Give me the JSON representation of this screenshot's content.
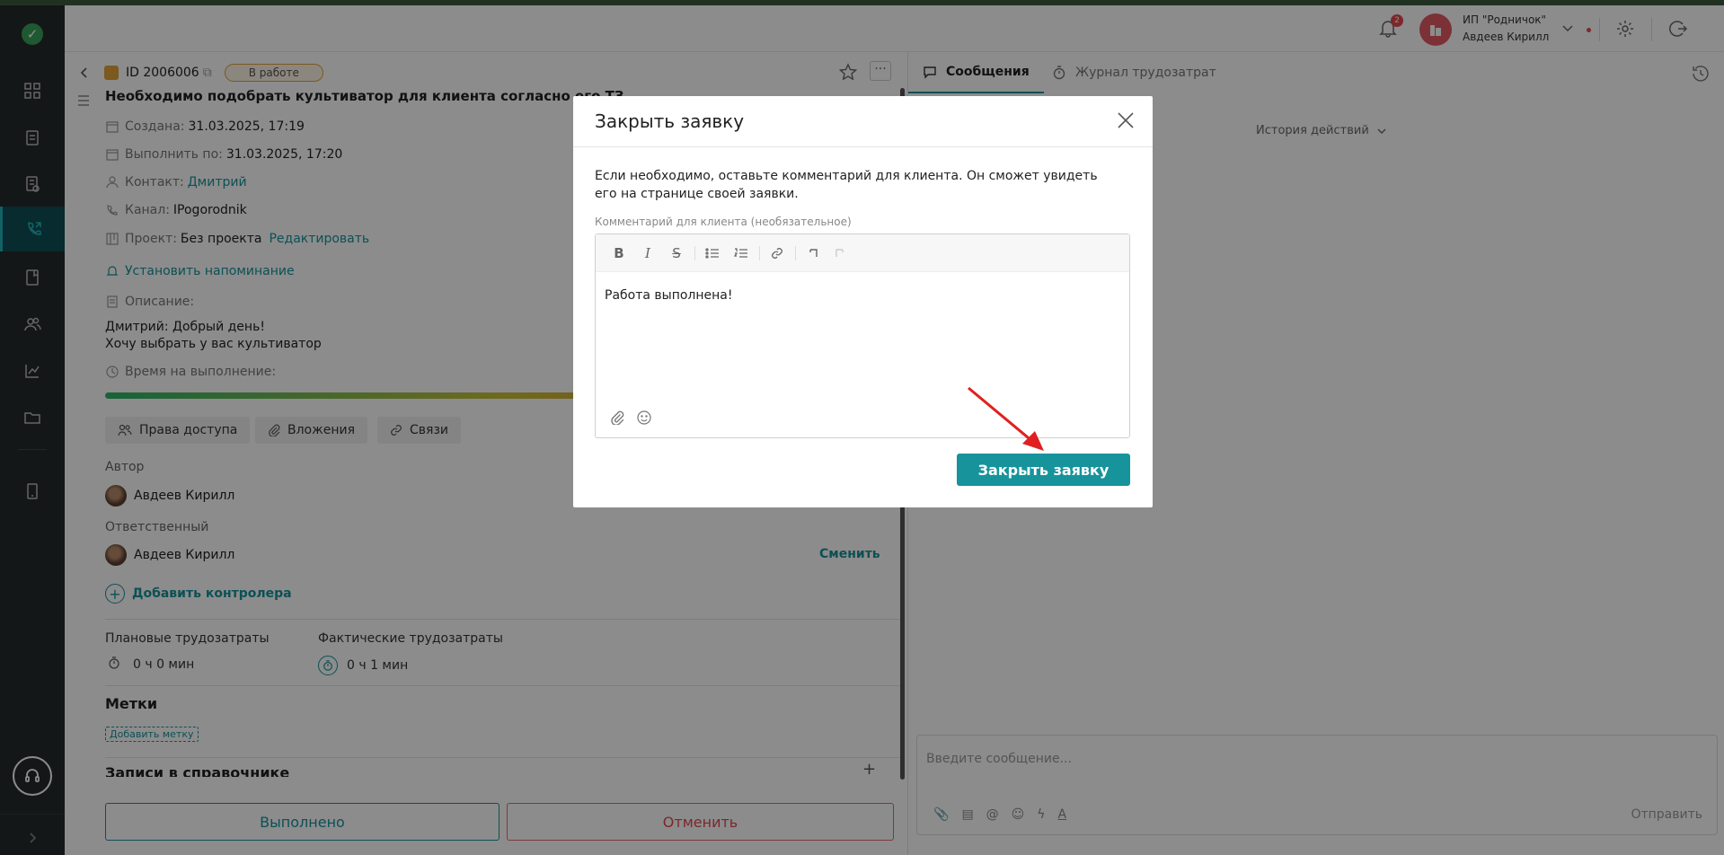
{
  "header": {
    "notifications_count": "2",
    "org_name": "ИП \"Родничок\"",
    "user_name": "Авдеев Кирилл"
  },
  "task": {
    "id": "ID 2006006",
    "status": "В работе",
    "title": "Необходимо подобрать культиватор для клиента согласно его ТЗ",
    "created_label": "Создана:",
    "created_value": "31.03.2025, 17:19",
    "due_label": "Выполнить по:",
    "due_value": "31.03.2025, 17:20",
    "contact_label": "Контакт:",
    "contact_value": "Дмитрий",
    "channel_label": "Канал:",
    "channel_value": "IPogorodnik",
    "project_label": "Проект:",
    "project_value": "Без проекта",
    "project_edit": "Редактировать",
    "reminder": "Установить напоминание",
    "description_label": "Описание:",
    "description_line1": "Дмитрий: Добрый день!",
    "description_line2": "Хочу выбрать у вас культиватор",
    "time_label": "Время на выполнение:",
    "chips": [
      "Права доступа",
      "Вложения",
      "Связи"
    ],
    "author_label": "Автор",
    "author_name": "Авдеев Кирилл",
    "responsible_label": "Ответственный",
    "responsible_name": "Авдеев Кирилл",
    "change_label": "Сменить",
    "add_controller": "Добавить контролера",
    "planned_label": "Плановые трудозатраты",
    "planned_value": "0 ч 0 мин",
    "actual_label": "Фактические трудозатраты",
    "actual_value": "0 ч 1 мин",
    "tags_label": "Метки",
    "add_tag": "Добавить метку",
    "records_label": "Записи в справочнике",
    "done_button": "Выполнено",
    "cancel_button": "Отменить"
  },
  "right_panel": {
    "tab_messages": "Сообщения",
    "tab_timelog": "Журнал трудозатрат",
    "history": "История действий",
    "message_placeholder": "Введите сообщение...",
    "send": "Отправить"
  },
  "modal": {
    "title": "Закрыть заявку",
    "description": "Если необходимо, оставьте комментарий для клиента. Он сможет увидеть его на странице своей заявки.",
    "comment_label": "Комментарий для клиента (необязательное)",
    "comment_text": "Работа выполнена!",
    "submit_button": "Закрыть заявку"
  },
  "colors": {
    "accent": "#17939b",
    "danger": "#e5484d",
    "sidebar": "#252a2c",
    "annotation_arrow": "#e02020"
  }
}
